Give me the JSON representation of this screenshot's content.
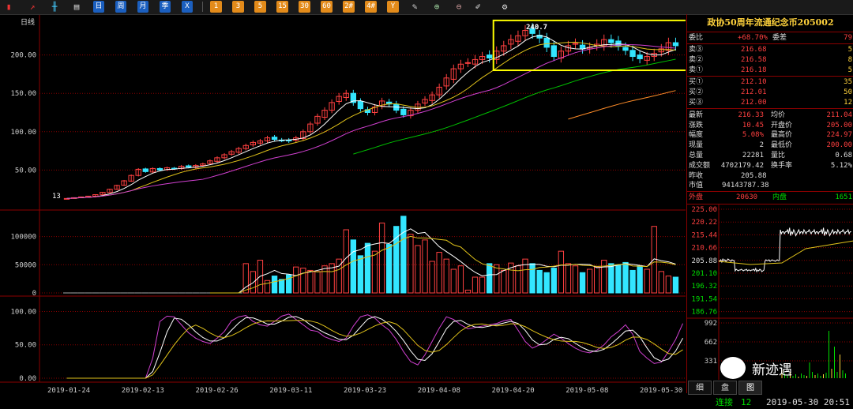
{
  "toolbar": {
    "period_buttons": [
      "日",
      "周",
      "月",
      "季",
      "X"
    ],
    "number_buttons": [
      "1",
      "3",
      "5",
      "15",
      "30",
      "60",
      "2#",
      "4#",
      "Y"
    ]
  },
  "chart": {
    "period_label": "日线",
    "high_label": "240.7",
    "low_label": "13",
    "price_ticks": [
      "200.00",
      "150.00",
      "100.00",
      "50.00"
    ],
    "volume_ticks": [
      "100000",
      "50000",
      "0"
    ],
    "indicator_ticks": [
      "100.00",
      "50.00",
      "0.00"
    ],
    "date_ticks": [
      "2019-01-24",
      "2019-02-13",
      "2019-02-26",
      "2019-03-11",
      "2019-03-23",
      "2019-04-08",
      "2019-04-20",
      "2019-05-08",
      "2019-05-30"
    ],
    "colors": {
      "up": "#ff4040",
      "down": "#33e6ff",
      "ma5": "#ffffff",
      "ma10": "#e0c21a",
      "ma20": "#d040d0",
      "ma60": "#00c000",
      "ma120": "#ff8c28",
      "highlight": "#ffff00",
      "grid": "#8b0000"
    }
  },
  "chart_data": {
    "type": "candlestick",
    "title": "",
    "closes": [
      13,
      14,
      15,
      16,
      18,
      21,
      25,
      30,
      36,
      43,
      51,
      48,
      52,
      50,
      53,
      52,
      55,
      54,
      56,
      58,
      62,
      66,
      70,
      74,
      78,
      82,
      86,
      88,
      92,
      90,
      89,
      88,
      92,
      100,
      110,
      120,
      128,
      138,
      146,
      150,
      138,
      130,
      125,
      132,
      140,
      136,
      128,
      122,
      128,
      136,
      142,
      148,
      158,
      170,
      182,
      188,
      190,
      194,
      198,
      196,
      205,
      212,
      220,
      225,
      232,
      228,
      222,
      210,
      198,
      205,
      212,
      215,
      208,
      210,
      214,
      220,
      216,
      212,
      206,
      198,
      195,
      198,
      202,
      208,
      216,
      212
    ],
    "volumes": [
      0,
      0,
      0,
      0,
      0,
      0,
      0,
      0,
      0,
      0,
      0,
      0,
      0,
      0,
      0,
      0,
      0,
      0,
      0,
      0,
      0,
      0,
      0,
      0,
      0,
      52000,
      38000,
      58000,
      22000,
      30000,
      24000,
      32000,
      46000,
      44000,
      40000,
      38000,
      48000,
      52000,
      60000,
      112000,
      94000,
      66000,
      88000,
      74000,
      124000,
      86000,
      118000,
      136000,
      104000,
      84000,
      94000,
      56000,
      72000,
      60000,
      42000,
      48000,
      5000,
      28000,
      28000,
      52000,
      50000,
      40000,
      53000,
      48000,
      60000,
      52000,
      40000,
      36000,
      44000,
      74000,
      52000,
      48000,
      36000,
      42000,
      46000,
      58000,
      52000,
      50000,
      54000,
      40000,
      48000,
      42000,
      118000,
      38000,
      30000,
      28000
    ],
    "indicator": [
      0,
      0,
      0,
      0,
      0,
      0,
      0,
      0,
      0,
      0,
      0,
      0,
      30,
      85,
      93,
      92,
      80,
      68,
      60,
      55,
      52,
      60,
      70,
      86,
      92,
      94,
      85,
      80,
      78,
      85,
      93,
      96,
      88,
      80,
      72,
      70,
      62,
      58,
      55,
      60,
      78,
      92,
      95,
      90,
      80,
      72,
      58,
      40,
      25,
      20,
      35,
      55,
      75,
      92,
      88,
      80,
      74,
      76,
      78,
      80,
      82,
      86,
      88,
      72,
      55,
      45,
      50,
      58,
      66,
      60,
      52,
      45,
      40,
      38,
      42,
      50,
      62,
      70,
      80,
      66,
      40,
      30,
      22,
      24,
      40,
      58,
      82
    ],
    "price_ylim": [
      0,
      250
    ],
    "volume_ylim": [
      0,
      140000
    ],
    "indicator_ylim": [
      0,
      110
    ]
  },
  "quote": {
    "title": "政协50周年流通纪念币205002",
    "ratio": {
      "label": "委比",
      "value": "+68.70%",
      "label2": "委差",
      "value2": "79"
    },
    "asks": [
      {
        "label": "卖③",
        "price": "216.68",
        "vol": "5"
      },
      {
        "label": "卖②",
        "price": "216.58",
        "vol": "8"
      },
      {
        "label": "卖①",
        "price": "216.18",
        "vol": "5"
      }
    ],
    "bids": [
      {
        "label": "买①",
        "price": "212.10",
        "vol": "35"
      },
      {
        "label": "买②",
        "price": "212.01",
        "vol": "50"
      },
      {
        "label": "买③",
        "price": "212.00",
        "vol": "12"
      }
    ],
    "stats": [
      {
        "l1": "最新",
        "v1": "216.33",
        "l2": "均价",
        "v2": "211.04"
      },
      {
        "l1": "涨跌",
        "v1": "10.45",
        "l2": "开盘价",
        "v2": "205.00"
      },
      {
        "l1": "幅度",
        "v1": "5.08%",
        "l2": "最高价",
        "v2": "224.97"
      },
      {
        "l1": "现量",
        "v1": "2",
        "l2": "最低价",
        "v2": "200.00"
      },
      {
        "l1": "总量",
        "v1": "22281",
        "l2": "量比",
        "v2": "0.68"
      },
      {
        "l1": "成交额",
        "v1": "4702179.42",
        "l2": "换手率",
        "v2": "5.12%"
      }
    ],
    "prev_close": {
      "label": "昨收",
      "value": "205.88"
    },
    "market_value": {
      "label": "市值",
      "value": "94143787.38"
    },
    "outer": {
      "label": "外盘",
      "value": "20630"
    },
    "inner": {
      "label": "内盘",
      "value": "1651"
    },
    "intraday_ticks": [
      "225.00",
      "220.22",
      "215.44",
      "210.66",
      "205.88",
      "201.10",
      "196.32",
      "191.54",
      "186.76"
    ],
    "intraday_vol_ticks": [
      "992",
      "662",
      "331"
    ]
  },
  "mini_tabs": [
    "细",
    "盘",
    "图"
  ],
  "status": {
    "label": "连接",
    "count": "12",
    "datetime": "2019-05-30 20:51"
  },
  "watermark": "新迹遇"
}
